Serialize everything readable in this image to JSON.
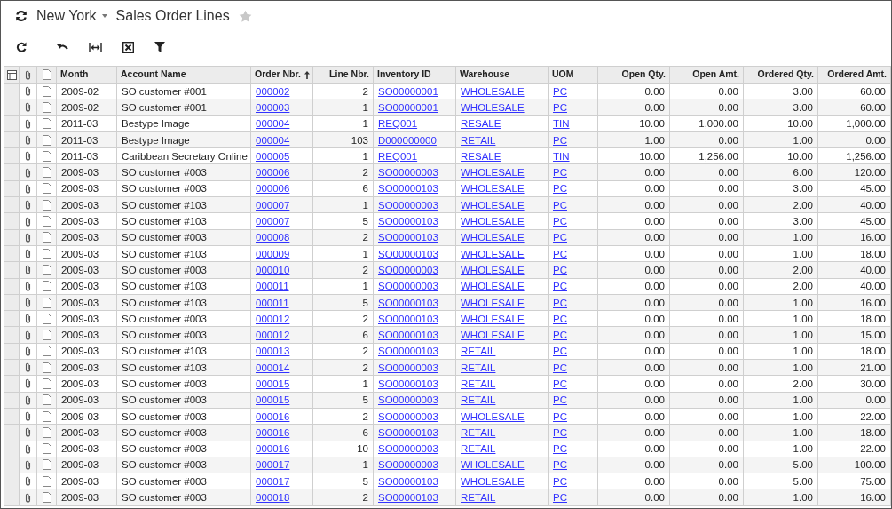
{
  "header": {
    "branch": "New York",
    "title": "Sales Order Lines",
    "favorite": false
  },
  "table": {
    "columns": [
      {
        "label": "Month",
        "kind": "text",
        "sorted": false
      },
      {
        "label": "Account Name",
        "kind": "text",
        "sorted": false
      },
      {
        "label": "Order Nbr.",
        "kind": "link",
        "sorted": true
      },
      {
        "label": "Line Nbr.",
        "kind": "number",
        "sorted": false
      },
      {
        "label": "Inventory ID",
        "kind": "link",
        "sorted": false
      },
      {
        "label": "Warehouse",
        "kind": "link",
        "sorted": false
      },
      {
        "label": "UOM",
        "kind": "link",
        "sorted": false
      },
      {
        "label": "Open Qty.",
        "kind": "number",
        "sorted": false
      },
      {
        "label": "Open Amt.",
        "kind": "number",
        "sorted": false
      },
      {
        "label": "Ordered Qty.",
        "kind": "number",
        "sorted": false
      },
      {
        "label": "Ordered Amt.",
        "kind": "number",
        "sorted": false
      }
    ],
    "rows": [
      [
        "2009-02",
        "SO customer #001",
        "000002",
        "2",
        "SO00000001",
        "WHOLESALE",
        "PC",
        "0.00",
        "0.00",
        "3.00",
        "60.00"
      ],
      [
        "2009-02",
        "SO customer #001",
        "000003",
        "1",
        "SO00000001",
        "WHOLESALE",
        "PC",
        "0.00",
        "0.00",
        "3.00",
        "60.00"
      ],
      [
        "2011-03",
        "Bestype Image",
        "000004",
        "1",
        "REQ001",
        "RESALE",
        "TIN",
        "10.00",
        "1,000.00",
        "10.00",
        "1,000.00"
      ],
      [
        "2011-03",
        "Bestype Image",
        "000004",
        "103",
        "D000000000",
        "RETAIL",
        "PC",
        "1.00",
        "0.00",
        "1.00",
        "0.00"
      ],
      [
        "2011-03",
        "Caribbean Secretary Online",
        "000005",
        "1",
        "REQ001",
        "RESALE",
        "TIN",
        "10.00",
        "1,256.00",
        "10.00",
        "1,256.00"
      ],
      [
        "2009-03",
        "SO customer #003",
        "000006",
        "2",
        "SO00000003",
        "WHOLESALE",
        "PC",
        "0.00",
        "0.00",
        "6.00",
        "120.00"
      ],
      [
        "2009-03",
        "SO customer #003",
        "000006",
        "6",
        "SO00000103",
        "WHOLESALE",
        "PC",
        "0.00",
        "0.00",
        "3.00",
        "45.00"
      ],
      [
        "2009-03",
        "SO customer #103",
        "000007",
        "1",
        "SO00000003",
        "WHOLESALE",
        "PC",
        "0.00",
        "0.00",
        "2.00",
        "40.00"
      ],
      [
        "2009-03",
        "SO customer #103",
        "000007",
        "5",
        "SO00000103",
        "WHOLESALE",
        "PC",
        "0.00",
        "0.00",
        "3.00",
        "45.00"
      ],
      [
        "2009-03",
        "SO customer #003",
        "000008",
        "2",
        "SO00000103",
        "WHOLESALE",
        "PC",
        "0.00",
        "0.00",
        "1.00",
        "16.00"
      ],
      [
        "2009-03",
        "SO customer #103",
        "000009",
        "1",
        "SO00000103",
        "WHOLESALE",
        "PC",
        "0.00",
        "0.00",
        "1.00",
        "18.00"
      ],
      [
        "2009-03",
        "SO customer #003",
        "000010",
        "2",
        "SO00000003",
        "WHOLESALE",
        "PC",
        "0.00",
        "0.00",
        "2.00",
        "40.00"
      ],
      [
        "2009-03",
        "SO customer #103",
        "000011",
        "1",
        "SO00000003",
        "WHOLESALE",
        "PC",
        "0.00",
        "0.00",
        "2.00",
        "40.00"
      ],
      [
        "2009-03",
        "SO customer #103",
        "000011",
        "5",
        "SO00000103",
        "WHOLESALE",
        "PC",
        "0.00",
        "0.00",
        "1.00",
        "16.00"
      ],
      [
        "2009-03",
        "SO customer #003",
        "000012",
        "2",
        "SO00000103",
        "WHOLESALE",
        "PC",
        "0.00",
        "0.00",
        "1.00",
        "18.00"
      ],
      [
        "2009-03",
        "SO customer #003",
        "000012",
        "6",
        "SO00000103",
        "WHOLESALE",
        "PC",
        "0.00",
        "0.00",
        "1.00",
        "15.00"
      ],
      [
        "2009-03",
        "SO customer #103",
        "000013",
        "2",
        "SO00000103",
        "RETAIL",
        "PC",
        "0.00",
        "0.00",
        "1.00",
        "18.00"
      ],
      [
        "2009-03",
        "SO customer #103",
        "000014",
        "2",
        "SO00000003",
        "RETAIL",
        "PC",
        "0.00",
        "0.00",
        "1.00",
        "21.00"
      ],
      [
        "2009-03",
        "SO customer #003",
        "000015",
        "1",
        "SO00000103",
        "RETAIL",
        "PC",
        "0.00",
        "0.00",
        "2.00",
        "30.00"
      ],
      [
        "2009-03",
        "SO customer #003",
        "000015",
        "5",
        "SO00000003",
        "RETAIL",
        "PC",
        "0.00",
        "0.00",
        "1.00",
        "0.00"
      ],
      [
        "2009-03",
        "SO customer #003",
        "000016",
        "2",
        "SO00000003",
        "WHOLESALE",
        "PC",
        "0.00",
        "0.00",
        "1.00",
        "22.00"
      ],
      [
        "2009-03",
        "SO customer #003",
        "000016",
        "6",
        "SO00000103",
        "RETAIL",
        "PC",
        "0.00",
        "0.00",
        "1.00",
        "18.00"
      ],
      [
        "2009-03",
        "SO customer #003",
        "000016",
        "10",
        "SO00000003",
        "RETAIL",
        "PC",
        "0.00",
        "0.00",
        "1.00",
        "22.00"
      ],
      [
        "2009-03",
        "SO customer #003",
        "000017",
        "1",
        "SO00000003",
        "WHOLESALE",
        "PC",
        "0.00",
        "0.00",
        "5.00",
        "100.00"
      ],
      [
        "2009-03",
        "SO customer #003",
        "000017",
        "5",
        "SO00000103",
        "WHOLESALE",
        "PC",
        "0.00",
        "0.00",
        "5.00",
        "75.00"
      ],
      [
        "2009-03",
        "SO customer #003",
        "000018",
        "2",
        "SO00000103",
        "RETAIL",
        "PC",
        "0.00",
        "0.00",
        "1.00",
        "16.00"
      ]
    ]
  }
}
